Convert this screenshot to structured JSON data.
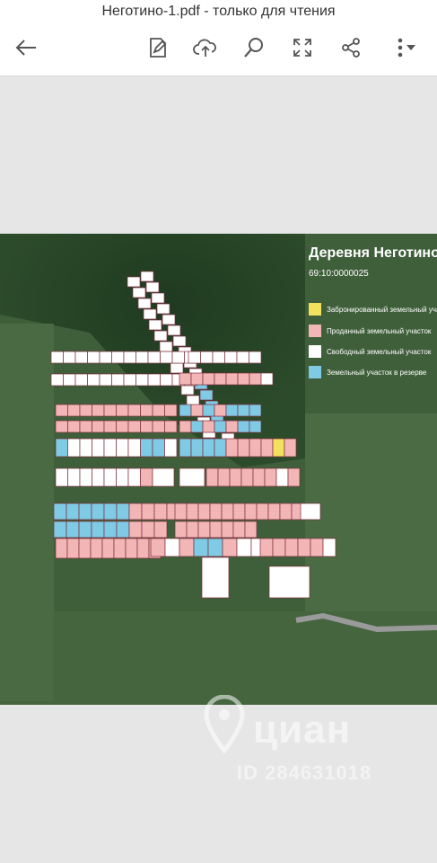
{
  "app": {
    "document_title": "Неготино-1.pdf - только для чтения"
  },
  "toolbar": {
    "back_icon": "arrow-left-icon",
    "edit_icon": "edit-document-icon",
    "upload_icon": "cloud-upload-icon",
    "search_icon": "search-icon",
    "fullscreen_icon": "fullscreen-icon",
    "share_icon": "share-icon",
    "more_icon": "more-vertical-icon"
  },
  "map": {
    "title": "Деревня Неготино",
    "cadastral": "69:10:0000025",
    "legend": [
      {
        "label": "Забронированный земельный участок",
        "color": "#f2e15c"
      },
      {
        "label": "Проданный земельный участок",
        "color": "#f3b6b6"
      },
      {
        "label": "Свободный земельный участок",
        "color": "#ffffff"
      },
      {
        "label": "Земельный участок в резерве",
        "color": "#7fcbe6"
      }
    ]
  },
  "watermark": {
    "brand": "циан",
    "id_text": "ID 284631018"
  }
}
